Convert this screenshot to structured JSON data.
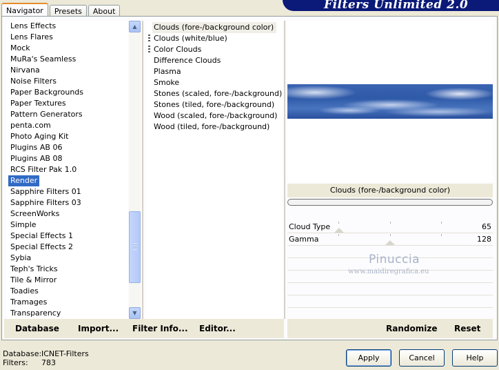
{
  "tabs": [
    {
      "label": "Navigator"
    },
    {
      "label": "Presets"
    },
    {
      "label": "About"
    }
  ],
  "brand": {
    "title": "Filters Unlimited 2.0"
  },
  "categories": [
    "Lens Effects",
    "Lens Flares",
    "Mock",
    "MuRa's Seamless",
    "Nirvana",
    "Noise Filters",
    "Paper Backgrounds",
    "Paper Textures",
    "Pattern Generators",
    "penta.com",
    "Photo Aging Kit",
    "Plugins AB 06",
    "Plugins AB 08",
    "RCS Filter Pak 1.0",
    "Render",
    "Sapphire Filters 01",
    "Sapphire Filters 03",
    "ScreenWorks",
    "Simple",
    "Special Effects 1",
    "Special Effects 2",
    "Sybia",
    "Teph's Tricks",
    "Tile & Mirror",
    "Toadies",
    "Tramages",
    "Transparency"
  ],
  "selected_category": "Render",
  "filters": [
    "Clouds (fore-/background color)",
    "Clouds (white/blue)",
    "Color Clouds",
    "Difference Clouds",
    "Plasma",
    "Smoke",
    "Stones (scaled, fore-/background)",
    "Stones (tiled, fore-/background)",
    "Wood (scaled, fore-/background)",
    "Wood (tiled, fore-/background)"
  ],
  "preview": {
    "filter_name": "Clouds (fore-/background color)"
  },
  "params": [
    {
      "label": "Cloud Type",
      "value": "65",
      "level": 65
    },
    {
      "label": "Gamma",
      "value": "128",
      "level": 128
    }
  ],
  "watermark": {
    "line1": "Pinuccia",
    "line2": "www.maidiregrafica.eu"
  },
  "toolbar": {
    "database": "Database",
    "import": "Import...",
    "filter_info": "Filter Info...",
    "editor": "Editor...",
    "randomize": "Randomize",
    "reset": "Reset"
  },
  "status": {
    "database_label": "Database:",
    "database_value": "ICNET-Filters",
    "filters_label": "Filters:",
    "filters_value": "783"
  },
  "buttons": {
    "apply": "Apply",
    "cancel": "Cancel",
    "help": "Help"
  },
  "colors": {
    "selection": "#316ac5",
    "brand": "#0b1a78",
    "dialog_bg": "#ece9d8"
  }
}
